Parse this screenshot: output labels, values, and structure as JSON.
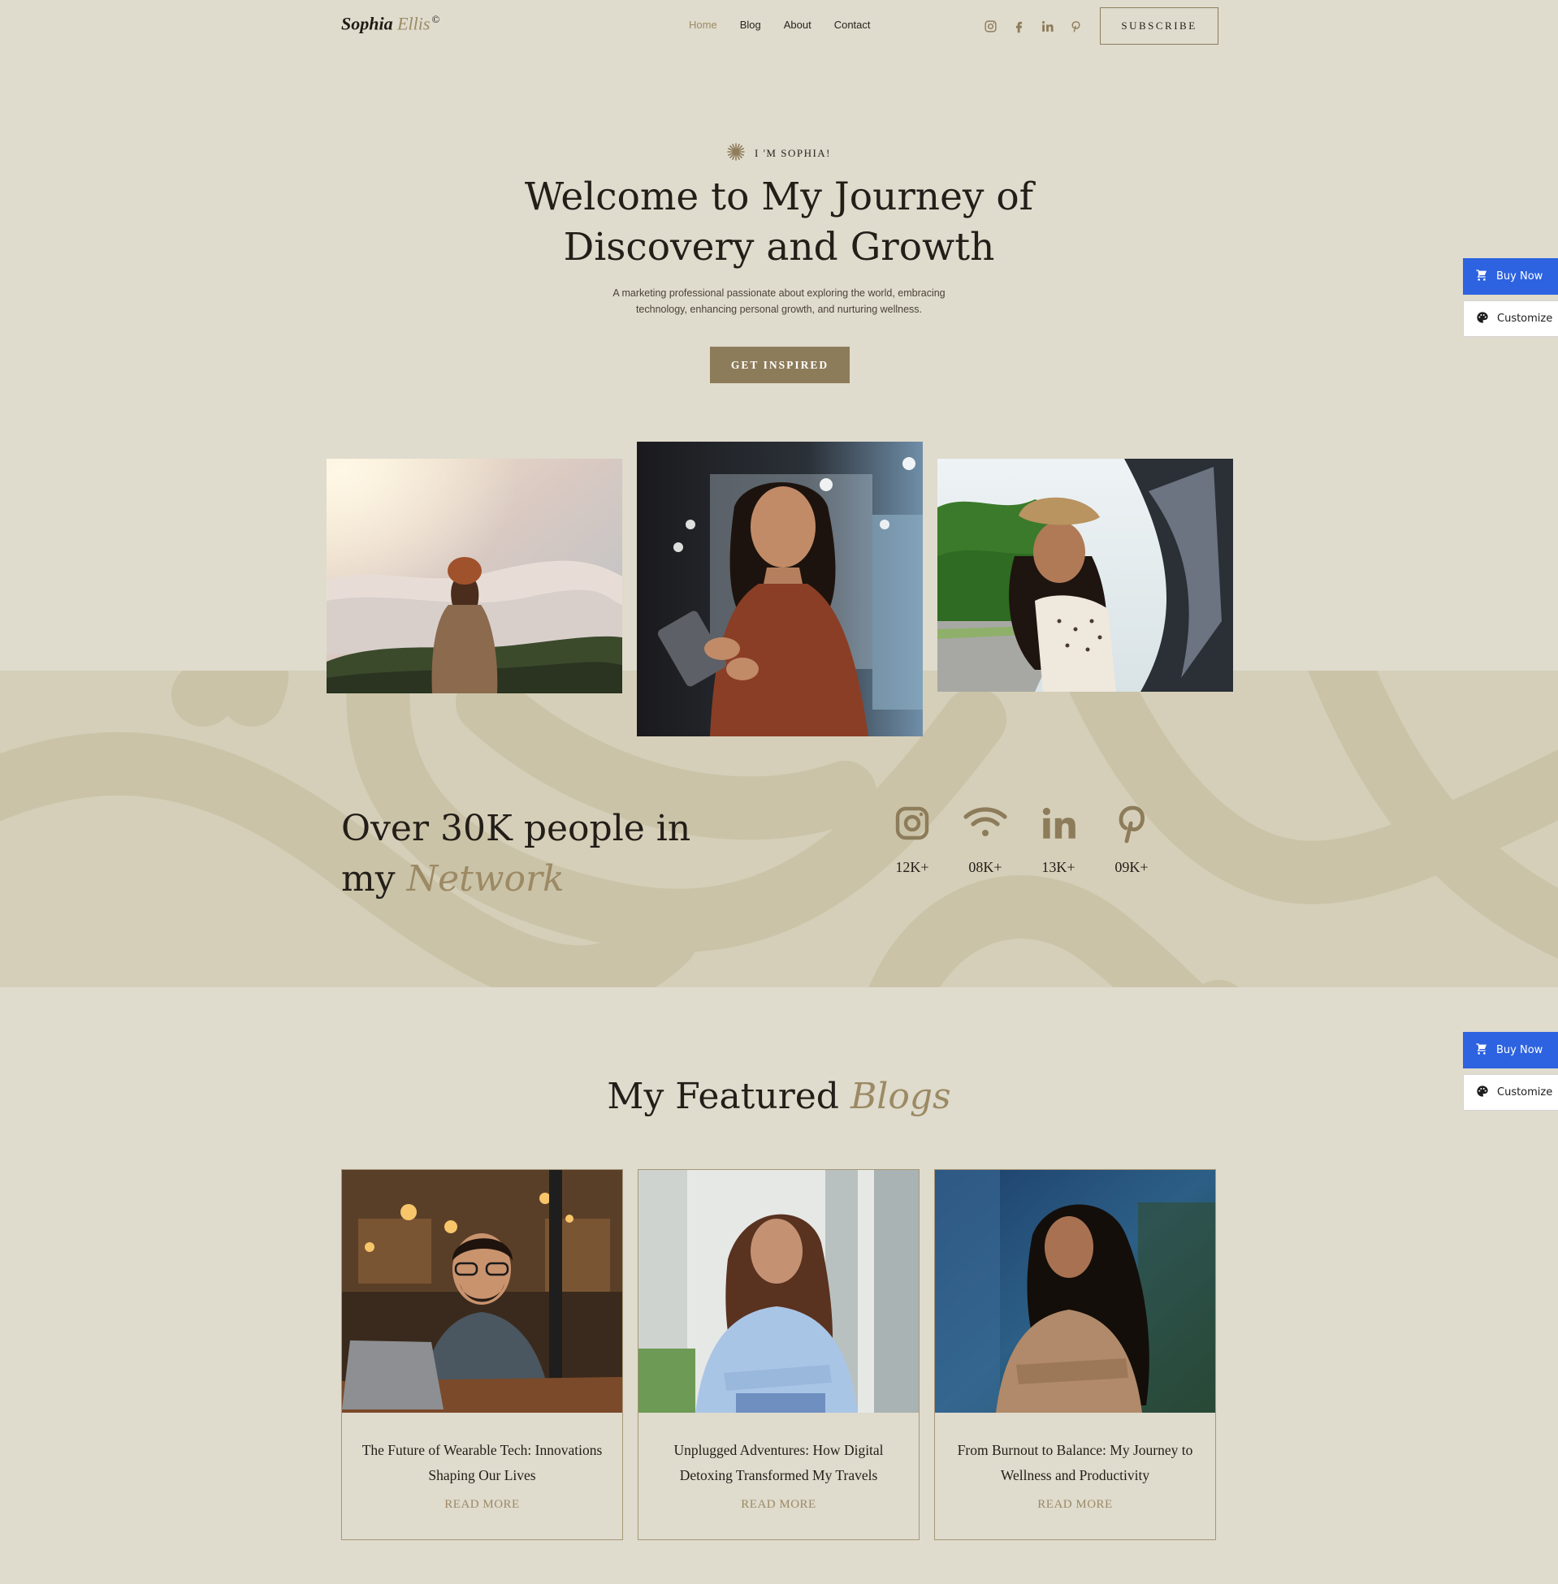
{
  "header": {
    "logo_first": "Sophia",
    "logo_second": "Ellis",
    "logo_mark": "©",
    "nav": [
      {
        "label": "Home",
        "active": true
      },
      {
        "label": "Blog",
        "active": false
      },
      {
        "label": "About",
        "active": false
      },
      {
        "label": "Contact",
        "active": false
      }
    ],
    "social_icons": [
      "instagram-icon",
      "facebook-icon",
      "linkedin-icon",
      "pinterest-icon"
    ],
    "subscribe_label": "SUBSCRIBE"
  },
  "hero": {
    "eyebrow": "I 'M SOPHIA!",
    "title_line1": "Welcome to My Journey of",
    "title_line2": "Discovery and Growth",
    "subtitle_line1": "A marketing professional passionate about exploring the world, embracing",
    "subtitle_line2": "technology, enhancing personal growth, and nurturing wellness.",
    "cta_label": "GET INSPIRED"
  },
  "network": {
    "title_line1": "Over 30K people in",
    "title_line2_plain": "my",
    "title_line2_accent": "Network",
    "stats": [
      {
        "icon": "instagram-icon",
        "value": "12K+"
      },
      {
        "icon": "rss-feed-icon",
        "value": "08K+"
      },
      {
        "icon": "linkedin-icon",
        "value": "13K+"
      },
      {
        "icon": "pinterest-icon",
        "value": "09K+"
      }
    ]
  },
  "featured": {
    "title_plain": "My Featured",
    "title_accent": "Blogs",
    "cards": [
      {
        "title": "The Future of Wearable Tech: Innovations Shaping Our Lives",
        "link": "READ MORE"
      },
      {
        "title": "Unplugged Adventures: How Digital Detoxing Transformed My Travels",
        "link": "READ MORE"
      },
      {
        "title": "From Burnout to Balance: My Journey to Wellness and Productivity",
        "link": "READ MORE"
      }
    ]
  },
  "floating": {
    "buy_label": "Buy Now",
    "customize_label": "Customize"
  },
  "colors": {
    "background": "#dfdbcd",
    "band": "#d5cfb9",
    "accent": "#9c8a64",
    "button": "#8d7c5a",
    "buy_blue": "#2d63e0"
  }
}
